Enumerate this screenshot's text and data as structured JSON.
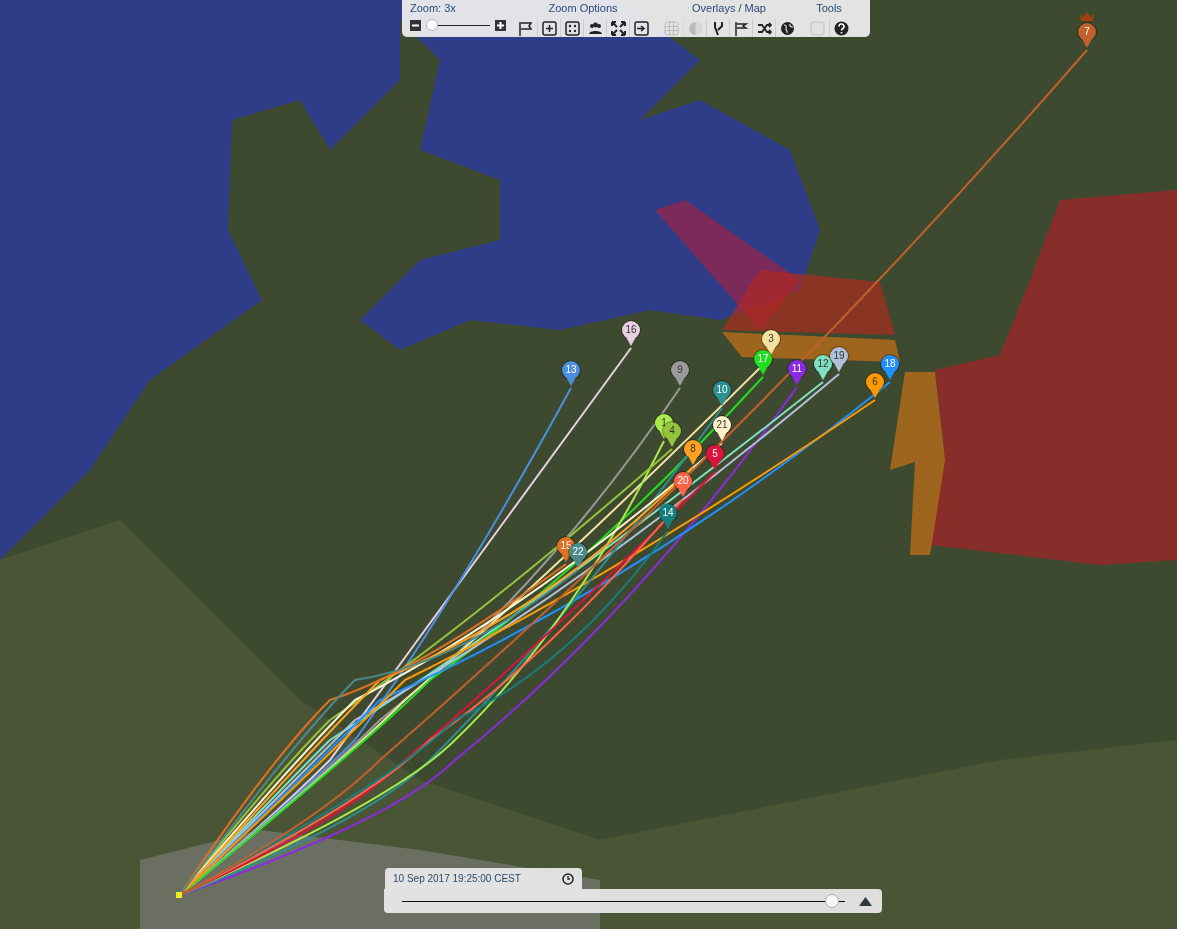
{
  "toolbar": {
    "zoom": {
      "label": "Zoom: 3x",
      "level": 0.1
    },
    "groups": [
      {
        "title": "Zoom Options",
        "icons": [
          {
            "disabled": false
          },
          {
            "disabled": false
          },
          {
            "disabled": false
          },
          {
            "disabled": false
          },
          {
            "disabled": false
          },
          {
            "disabled": false
          }
        ]
      },
      {
        "title": "Overlays / Map",
        "icons": [
          {
            "disabled": true
          },
          {
            "disabled": true
          },
          {
            "disabled": false
          },
          {
            "disabled": false
          },
          {
            "disabled": false
          },
          {
            "disabled": false
          }
        ]
      },
      {
        "title": "Tools",
        "icons": [
          {
            "disabled": true
          },
          {
            "disabled": false
          }
        ]
      }
    ]
  },
  "markers": [
    {
      "label": "16",
      "color": "#e6cfe0"
    },
    {
      "label": "13",
      "color": "#4a8fe0"
    },
    {
      "label": "9",
      "color": "#9a9a9a"
    },
    {
      "label": "3",
      "color": "#f3e3a0"
    },
    {
      "label": "17",
      "color": "#22dd22"
    },
    {
      "label": "11",
      "color": "#8a2be2"
    },
    {
      "label": "12",
      "color": "#7fe0c0"
    },
    {
      "label": "19",
      "color": "#b0c0d8"
    },
    {
      "label": "18",
      "color": "#1e90ff"
    },
    {
      "label": "6",
      "color": "#ff9900"
    },
    {
      "label": "10",
      "color": "#2a9090"
    },
    {
      "label": "1",
      "color": "#a8e84a"
    },
    {
      "label": "4",
      "color": "#94c43a"
    },
    {
      "label": "21",
      "color": "#fff3cc"
    },
    {
      "label": "8",
      "color": "#ffa020"
    },
    {
      "label": "5",
      "color": "#dc143c"
    },
    {
      "label": "20",
      "color": "#ff6347"
    },
    {
      "label": "14",
      "color": "#138080"
    },
    {
      "label": "15",
      "color": "#e07020"
    },
    {
      "label": "22",
      "color": "#4a8a8a"
    },
    {
      "label": "7",
      "color": "#c0602c",
      "leader": true
    }
  ],
  "timeline": {
    "time": "10 Sep 2017 19:25:00 CEST",
    "level": 0.97
  }
}
